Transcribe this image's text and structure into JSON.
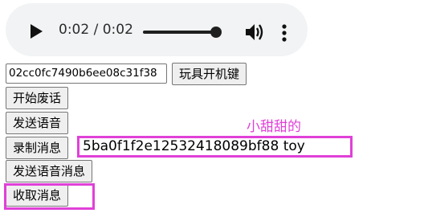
{
  "audio_player": {
    "time_display": "0:02 / 0:02",
    "progress": 1.0,
    "icons": [
      "play-icon",
      "volume-icon",
      "more-options-icon"
    ]
  },
  "controls": {
    "id_field_value": "02cc0fc7490b6ee08c31f38",
    "toy_key_button": "玩具开机键",
    "start_nonsense_button": "开始废话",
    "send_voice_button": "发送语音",
    "record_message_button": "录制消息",
    "send_voice_message_button": "发送语音消息",
    "receive_message_button": "收取消息"
  },
  "annotation": {
    "label": "小甜甜的",
    "highlight_text": "5ba0f1f2e12532418089bf88 toy",
    "color": "#e040d8"
  }
}
